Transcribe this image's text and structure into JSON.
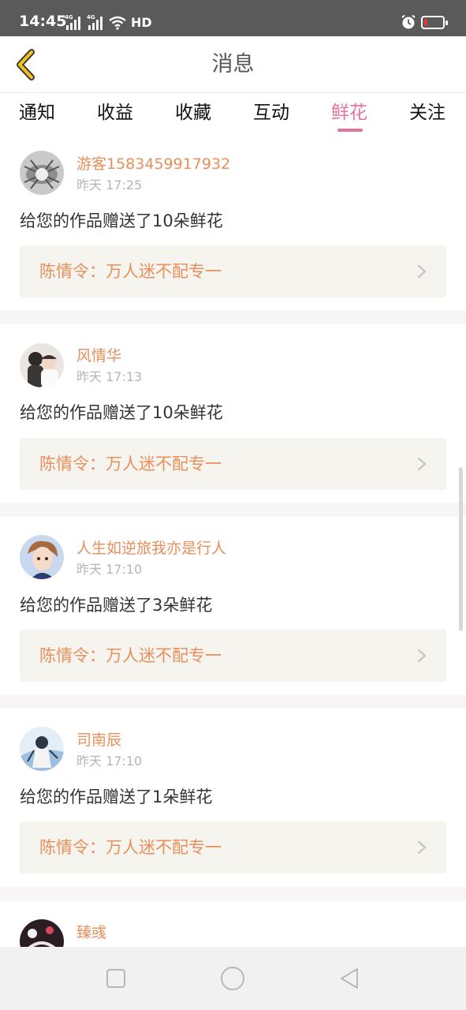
{
  "status_bar": {
    "time": "14:45",
    "signal1_label": "4G",
    "signal2_label": "4G",
    "hd_label": "HD",
    "icons": [
      "signal-icon",
      "signal-icon",
      "wifi-icon",
      "alarm-icon",
      "battery-icon"
    ],
    "battery_level": 0.1,
    "battery_color": "#e23a3a"
  },
  "header": {
    "title": "消息",
    "back_icon": "chevron-left-icon",
    "back_color": "#f2c31a"
  },
  "tabs": {
    "items": [
      "通知",
      "收益",
      "收藏",
      "互动",
      "鲜花",
      "关注"
    ],
    "active": "鲜花",
    "active_color": "#e8739b"
  },
  "messages": [
    {
      "username": "游客1583459917932",
      "time": "昨天 17:25",
      "text": "给您的作品赠送了10朵鲜花",
      "work": "陈情令：万人迷不配专一"
    },
    {
      "username": "风情华",
      "time": "昨天 17:13",
      "text": "给您的作品赠送了10朵鲜花",
      "work": "陈情令：万人迷不配专一"
    },
    {
      "username": "人生如逆旅我亦是行人",
      "time": "昨天 17:10",
      "text": "给您的作品赠送了3朵鲜花",
      "work": "陈情令：万人迷不配专一"
    },
    {
      "username": "司南辰",
      "time": "昨天 17:10",
      "text": "给您的作品赠送了1朵鲜花",
      "work": "陈情令：万人迷不配专一"
    },
    {
      "username": "臻彧",
      "time": "",
      "text": "",
      "work": ""
    }
  ],
  "colors": {
    "username": "#e88f5c",
    "work_box_bg": "#f5f4ee"
  },
  "nav_bar": {
    "icons": [
      "square-icon",
      "circle-icon",
      "triangle-back-icon"
    ]
  }
}
